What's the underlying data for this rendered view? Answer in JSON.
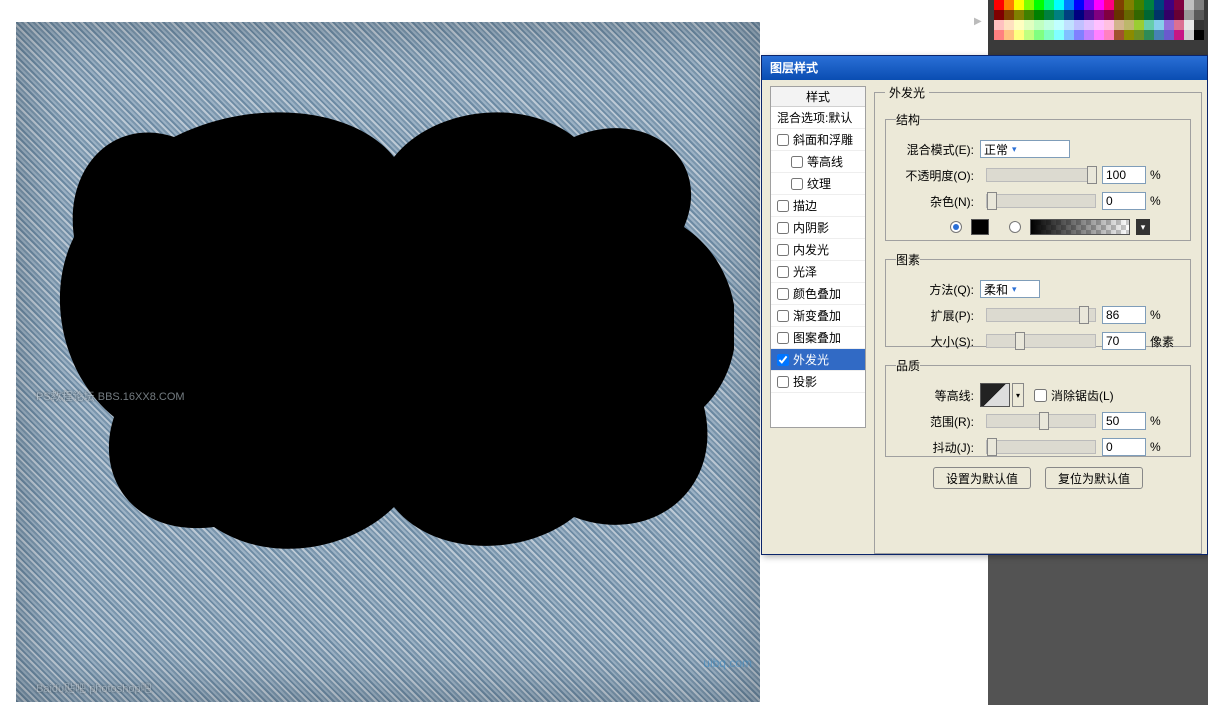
{
  "dialog": {
    "title": "图层样式",
    "styles_header": "样式",
    "blending_options": "混合选项:默认",
    "items": [
      {
        "label": "斜面和浮雕",
        "checked": false,
        "indent": false
      },
      {
        "label": "等高线",
        "checked": false,
        "indent": true
      },
      {
        "label": "纹理",
        "checked": false,
        "indent": true
      },
      {
        "label": "描边",
        "checked": false,
        "indent": false
      },
      {
        "label": "内阴影",
        "checked": false,
        "indent": false
      },
      {
        "label": "内发光",
        "checked": false,
        "indent": false
      },
      {
        "label": "光泽",
        "checked": false,
        "indent": false
      },
      {
        "label": "颜色叠加",
        "checked": false,
        "indent": false
      },
      {
        "label": "渐变叠加",
        "checked": false,
        "indent": false
      },
      {
        "label": "图案叠加",
        "checked": false,
        "indent": false
      },
      {
        "label": "外发光",
        "checked": true,
        "indent": false,
        "selected": true
      },
      {
        "label": "投影",
        "checked": false,
        "indent": false
      }
    ],
    "outer_glow": {
      "section_title": "外发光",
      "structure": {
        "legend": "结构",
        "blend_mode_label": "混合模式(E):",
        "blend_mode_value": "正常",
        "opacity_label": "不透明度(O):",
        "opacity_value": "100",
        "opacity_unit": "%",
        "noise_label": "杂色(N):",
        "noise_value": "0",
        "noise_unit": "%",
        "color_hex": "#000000"
      },
      "elements": {
        "legend": "图素",
        "technique_label": "方法(Q):",
        "technique_value": "柔和",
        "spread_label": "扩展(P):",
        "spread_value": "86",
        "spread_unit": "%",
        "size_label": "大小(S):",
        "size_value": "70",
        "size_unit": "像素"
      },
      "quality": {
        "legend": "品质",
        "contour_label": "等高线:",
        "antialias_label": "消除锯齿(L)",
        "antialias_checked": false,
        "range_label": "范围(R):",
        "range_value": "50",
        "range_unit": "%",
        "jitter_label": "抖动(J):",
        "jitter_value": "0",
        "jitter_unit": "%"
      },
      "buttons": {
        "set_default": "设置为默认值",
        "reset_default": "复位为默认值"
      }
    }
  },
  "watermarks": {
    "w1": "PS教程论坛\nBBS.16XX8.COM",
    "w2": "Baidu贴吧  photoshop吧",
    "w3": "UiBQ.CoM",
    "w4": "uibq.com"
  },
  "swatch_colors": [
    "#ff0000",
    "#ff7f00",
    "#ffff00",
    "#7fff00",
    "#00ff00",
    "#00ff7f",
    "#00ffff",
    "#007fff",
    "#0000ff",
    "#7f00ff",
    "#ff00ff",
    "#ff007f",
    "#804000",
    "#808000",
    "#408000",
    "#008040",
    "#004080",
    "#400080",
    "#800040",
    "#c0c0c0",
    "#808080",
    "#800000",
    "#804000",
    "#808000",
    "#408000",
    "#008000",
    "#008040",
    "#008080",
    "#004080",
    "#000080",
    "#400080",
    "#800080",
    "#800040",
    "#663300",
    "#666600",
    "#336600",
    "#006633",
    "#003366",
    "#330066",
    "#660033",
    "#999999",
    "#595959",
    "#ffc0c0",
    "#ffe0c0",
    "#ffffc0",
    "#e0ffc0",
    "#c0ffc0",
    "#c0ffe0",
    "#c0ffff",
    "#c0e0ff",
    "#c0c0ff",
    "#e0c0ff",
    "#ffc0ff",
    "#ffc0e0",
    "#d2b48c",
    "#bdb76b",
    "#9acd32",
    "#66cdaa",
    "#87ceeb",
    "#9370db",
    "#db7093",
    "#e6e6e6",
    "#333333",
    "#ff8080",
    "#ffc080",
    "#ffff80",
    "#c0ff80",
    "#80ff80",
    "#80ffc0",
    "#80ffff",
    "#80c0ff",
    "#8080ff",
    "#c080ff",
    "#ff80ff",
    "#ff80c0",
    "#a0522d",
    "#8b8b00",
    "#6b8e23",
    "#2e8b57",
    "#4682b4",
    "#6a5acd",
    "#c71585",
    "#cccccc",
    "#000000"
  ]
}
